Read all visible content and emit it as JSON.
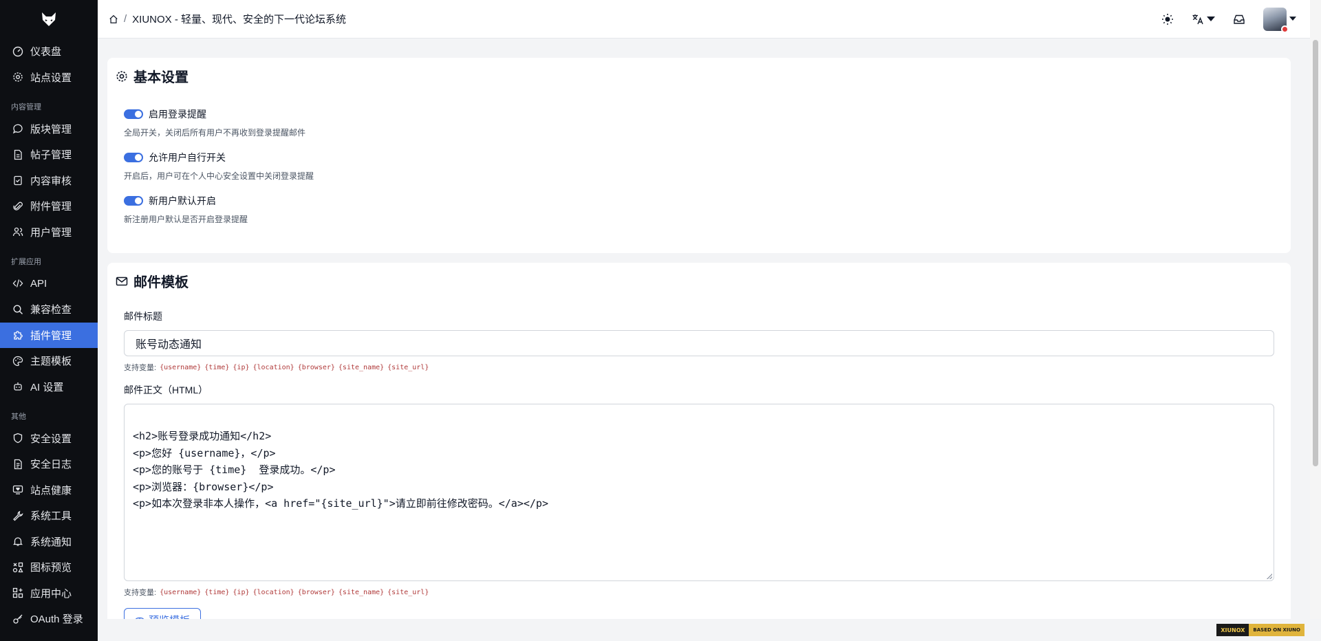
{
  "sidebar": {
    "items": [
      {
        "label": "仪表盘",
        "icon": "gauge-icon"
      },
      {
        "label": "站点设置",
        "icon": "gear-icon"
      }
    ],
    "sections": [
      {
        "title": "内容管理",
        "items": [
          {
            "label": "版块管理",
            "icon": "chat-bubble-icon"
          },
          {
            "label": "帖子管理",
            "icon": "document-icon"
          },
          {
            "label": "内容审核",
            "icon": "clipboard-check-icon"
          },
          {
            "label": "附件管理",
            "icon": "paperclip-icon"
          },
          {
            "label": "用户管理",
            "icon": "users-icon"
          }
        ]
      },
      {
        "title": "扩展应用",
        "items": [
          {
            "label": "API",
            "icon": "code-icon"
          },
          {
            "label": "兼容检查",
            "icon": "search-icon"
          },
          {
            "label": "插件管理",
            "icon": "puzzle-icon",
            "active": true
          },
          {
            "label": "主题模板",
            "icon": "palette-icon"
          },
          {
            "label": "AI 设置",
            "icon": "robot-icon"
          }
        ]
      },
      {
        "title": "其他",
        "items": [
          {
            "label": "安全设置",
            "icon": "shield-icon"
          },
          {
            "label": "安全日志",
            "icon": "log-icon"
          },
          {
            "label": "站点健康",
            "icon": "monitor-heart-icon"
          },
          {
            "label": "系统工具",
            "icon": "wrench-icon"
          },
          {
            "label": "系统通知",
            "icon": "bell-icon"
          },
          {
            "label": "图标预览",
            "icon": "shapes-icon"
          },
          {
            "label": "应用中心",
            "icon": "apps-icon"
          },
          {
            "label": "OAuth 登录",
            "icon": "key-icon"
          }
        ]
      }
    ]
  },
  "header": {
    "breadcrumb_sep": "/",
    "title": "XIUNOX - 轻量、现代、安全的下一代论坛系统"
  },
  "basic": {
    "title": "基本设置",
    "toggles": [
      {
        "label": "启用登录提醒",
        "hint": "全局开关，关闭后所有用户不再收到登录提醒邮件",
        "on": true
      },
      {
        "label": "允许用户自行开关",
        "hint": "开启后，用户可在个人中心安全设置中关闭登录提醒",
        "on": true
      },
      {
        "label": "新用户默认开启",
        "hint": "新注册用户默认是否开启登录提醒",
        "on": true
      }
    ]
  },
  "mail": {
    "title": "邮件模板",
    "subject_label": "邮件标题",
    "subject_value": "账号动态通知",
    "vars_label": "支持变量:",
    "vars": [
      "{username}",
      "{time}",
      "{ip}",
      "{location}",
      "{browser}",
      "{site_name}",
      "{site_url}"
    ],
    "body_label": "邮件正文（HTML）",
    "body_lines": [
      "<h2>账号登录成功通知</h2>",
      "<p>您好 {username}，</p>",
      "<p>您的账号于 {time}  登录成功。</p>",
      "<p>浏览器：{browser}</p>",
      "<p>如本次登录非本人操作，<a href=\"{site_url}\">请立即前往修改密码。</a></p>"
    ],
    "preview_label": "预览模板"
  },
  "footer_badge": {
    "left": "XIUNOX",
    "right": "BASED ON XIUNO"
  },
  "colors": {
    "accent": "#3b6fe0",
    "sidebar_bg": "#0d0f13",
    "var_code": "#b03a3a"
  }
}
